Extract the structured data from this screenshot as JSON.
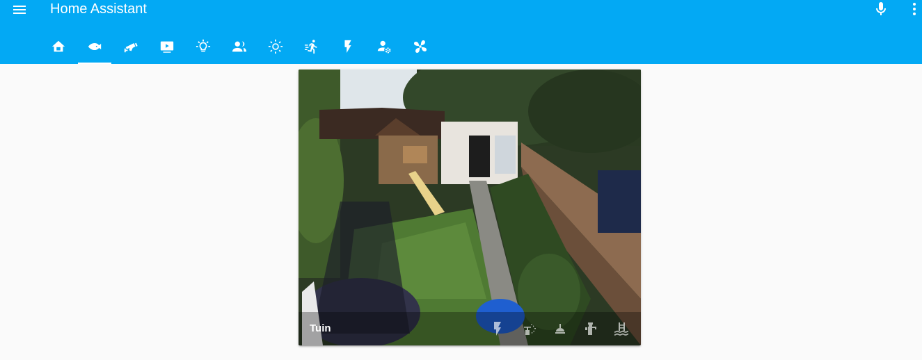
{
  "app": {
    "title": "Home Assistant",
    "accent_color": "#03a9f4"
  },
  "toolbar": {
    "menu_icon": "menu-icon",
    "mic_icon": "microphone-icon",
    "more_icon": "dots-vertical-icon"
  },
  "tabs": [
    {
      "icon": "home-icon",
      "selected": false
    },
    {
      "icon": "fish-icon",
      "selected": true
    },
    {
      "icon": "cctv-icon",
      "selected": false
    },
    {
      "icon": "television-play-icon",
      "selected": false
    },
    {
      "icon": "lightbulb-icon",
      "selected": false
    },
    {
      "icon": "account-multiple-icon",
      "selected": false
    },
    {
      "icon": "weather-sunny-icon",
      "selected": false
    },
    {
      "icon": "run-icon",
      "selected": false
    },
    {
      "icon": "flash-icon",
      "selected": false
    },
    {
      "icon": "account-settings-icon",
      "selected": false
    },
    {
      "icon": "fan-icon",
      "selected": false
    }
  ],
  "card": {
    "title": "Tuin",
    "entities": [
      {
        "icon": "flash-icon"
      },
      {
        "icon": "sprinkler-icon"
      },
      {
        "icon": "lamp-icon"
      },
      {
        "icon": "water-pump-icon"
      },
      {
        "icon": "pool-icon"
      }
    ]
  }
}
